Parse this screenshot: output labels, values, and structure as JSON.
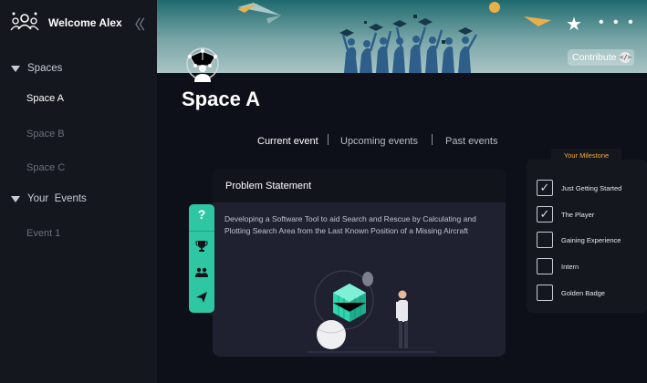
{
  "sidebar": {
    "welcome": "Welcome Alex",
    "sections": [
      {
        "label": "Spaces",
        "items": [
          "Space A",
          "Space B",
          "Space C"
        ],
        "active": "Space A"
      },
      {
        "label": "Your  Events",
        "items": [
          "Event 1"
        ]
      }
    ],
    "icons": {
      "logo": "people-network-icon",
      "collapse": "double-chevron-left-icon"
    }
  },
  "banner": {
    "contribute_label": "Contribute",
    "contribute_icon": "code-icon",
    "star_icon": "star-icon",
    "more_icon": "more-dots-icon",
    "more_glyph": "• • •"
  },
  "space": {
    "title": "Space A",
    "avatar_icon": "network-person-icon"
  },
  "tabs": [
    {
      "label": "Current event",
      "active": true
    },
    {
      "label": "Upcoming events",
      "active": false
    },
    {
      "label": "Past events",
      "active": false
    }
  ],
  "problem": {
    "heading": "Problem Statement",
    "text": "Developing a Software Tool to aid Search and Rescue by Calculating and Plotting Search Area from the Last Known Position of a Missing Aircraft"
  },
  "fab": {
    "help": "?",
    "icons": [
      "help-icon",
      "trophy-icon",
      "team-icon",
      "send-icon"
    ]
  },
  "milestones": {
    "title": "Your Milestone",
    "items": [
      {
        "label": "Just Getting Started",
        "checked": true
      },
      {
        "label": "The Player",
        "checked": true
      },
      {
        "label": "Gaining Experience",
        "checked": false
      },
      {
        "label": "Intern",
        "checked": false
      },
      {
        "label": "Golden Badge",
        "checked": false
      }
    ]
  },
  "colors": {
    "accent": "#2fc7a3",
    "milestone_title": "#f0a833",
    "background": "#0e1019",
    "sidebar": "#15171f"
  }
}
